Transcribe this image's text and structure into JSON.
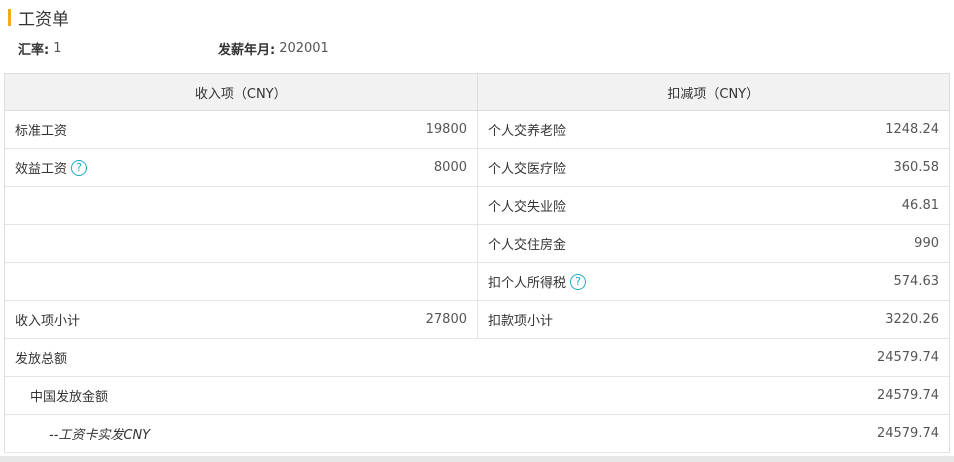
{
  "page": {
    "title": "工资单"
  },
  "meta": {
    "rate_label": "汇率:",
    "rate_value": "1",
    "month_label": "发薪年月:",
    "month_value": "202001"
  },
  "table": {
    "income_header": "收入项（CNY）",
    "deduction_header": "扣减项（CNY）",
    "rows": [
      {
        "income_label": "标准工资",
        "income_value": "19800",
        "deduction_label": "个人交养老险",
        "deduction_value": "1248.24"
      },
      {
        "income_label": "效益工资",
        "income_value": "8000",
        "deduction_label": "个人交医疗险",
        "deduction_value": "360.58"
      },
      {
        "income_label": "",
        "income_value": "",
        "deduction_label": "个人交失业险",
        "deduction_value": "46.81"
      },
      {
        "income_label": "",
        "income_value": "",
        "deduction_label": "个人交住房金",
        "deduction_value": "990"
      },
      {
        "income_label": "",
        "income_value": "",
        "deduction_label": "扣个人所得税",
        "deduction_value": "574.63"
      },
      {
        "income_label": "收入项小计",
        "income_value": "27800",
        "deduction_label": "扣款项小计",
        "deduction_value": "3220.26"
      }
    ],
    "total_label": "发放总额",
    "total_value": "24579.74",
    "china_label": "中国发放金额",
    "china_value": "24579.74",
    "card_label": "--工资卡实发CNY",
    "card_value": "24579.74"
  },
  "colors": {
    "accent": "#f5a623",
    "help_icon": "#1fa9c9",
    "header_bg": "#f2f2f2",
    "border": "#dddddd"
  },
  "icons": {
    "help": "question-mark-circle-icon"
  }
}
